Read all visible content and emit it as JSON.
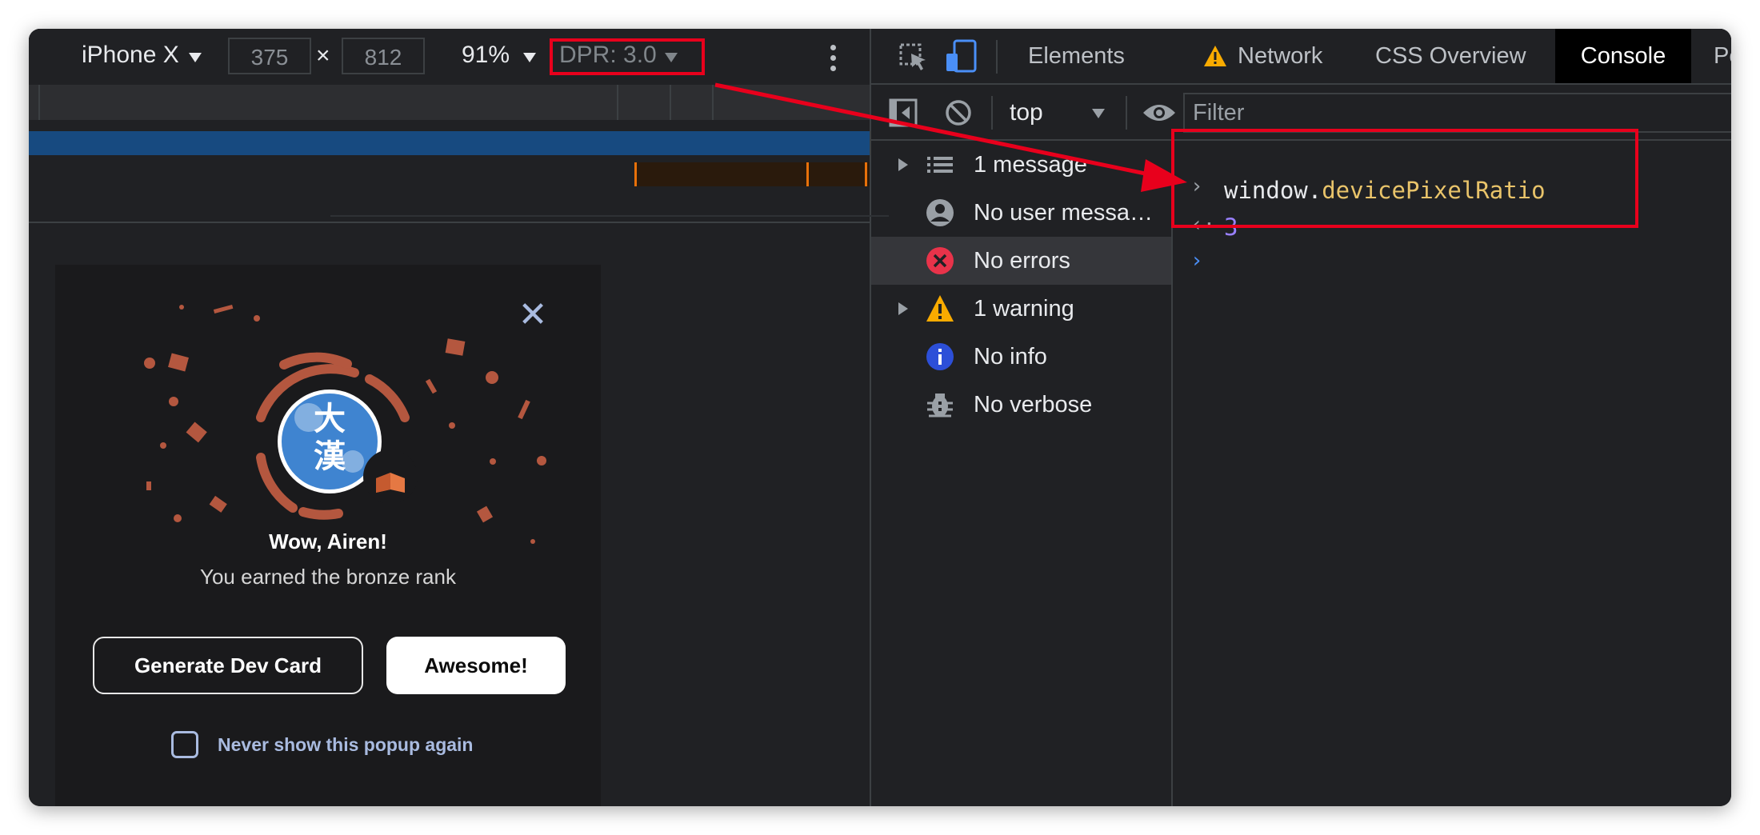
{
  "device_toolbar": {
    "device": "iPhone X",
    "width": "375",
    "times": "×",
    "height": "812",
    "zoom": "91%",
    "dpr": "DPR: 3.0"
  },
  "popup": {
    "close_glyph": "✕",
    "title": "Wow, Airen!",
    "subtitle": "You earned the bronze rank",
    "generate_button": "Generate Dev Card",
    "awesome_button": "Awesome!",
    "never_show": "Never show this popup again"
  },
  "devtools": {
    "tabs": [
      {
        "label": "Elements"
      },
      {
        "label": "Network"
      },
      {
        "label": "CSS Overview"
      },
      {
        "label": "Console"
      },
      {
        "label": "Perfo"
      }
    ],
    "context": "top",
    "filter_placeholder": "Filter",
    "sidebar": [
      {
        "label": "1 message"
      },
      {
        "label": "No user messa…"
      },
      {
        "label": "No errors"
      },
      {
        "label": "1 warning"
      },
      {
        "label": "No info"
      },
      {
        "label": "No verbose"
      }
    ],
    "console": {
      "input_obj": "window.",
      "input_prop": "devicePixelRatio",
      "result": "3"
    }
  },
  "colors": {
    "highlight": "#e8001c",
    "bronze": "#b4573f",
    "badge_blue": "#1d6fc8",
    "property_yellow": "#e9c46a",
    "number_purple": "#9980ff"
  }
}
